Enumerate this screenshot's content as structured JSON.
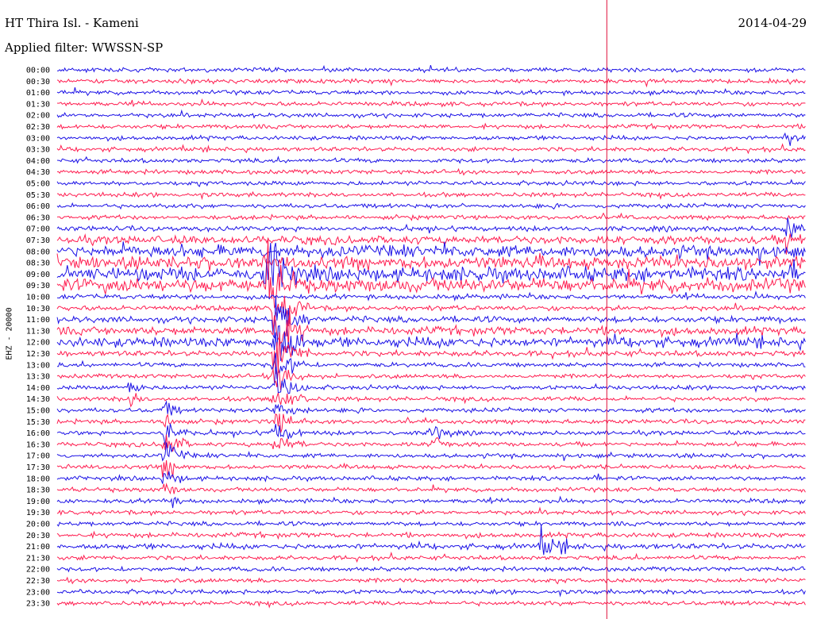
{
  "header": {
    "station": "HT Thira Isl. - Kameni",
    "filter": "Applied filter: WWSSN-SP",
    "date": "2014-04-29"
  },
  "channel_label": "EHZ - 20000",
  "colors": {
    "trace_a": "#1a10e6",
    "trace_b": "#ff1c4f",
    "marker": "#e0103a",
    "background": "#ffffff"
  },
  "chart_data": {
    "type": "line",
    "title": "HT Thira Isl. - Kameni",
    "subtitle": "Applied filter: WWSSN-SP",
    "ylabel": "EHZ - 20000",
    "row_labels": [
      "00:00",
      "00:30",
      "01:00",
      "01:30",
      "02:00",
      "02:30",
      "03:00",
      "03:30",
      "04:00",
      "04:30",
      "05:00",
      "05:30",
      "06:00",
      "06:30",
      "07:00",
      "07:30",
      "08:00",
      "08:30",
      "09:00",
      "09:30",
      "10:00",
      "10:30",
      "11:00",
      "11:30",
      "12:00",
      "12:30",
      "13:00",
      "13:30",
      "14:00",
      "14:30",
      "15:00",
      "15:30",
      "16:00",
      "16:30",
      "17:00",
      "17:30",
      "18:00",
      "18:30",
      "19:00",
      "19:30",
      "20:00",
      "20:30",
      "21:00",
      "21:30",
      "22:00",
      "22:30",
      "23:00",
      "23:30"
    ],
    "row_duration_min": 30,
    "trace_colors_alternate": [
      "blue",
      "red"
    ],
    "noise_level": [
      0.3,
      0.3,
      0.3,
      0.3,
      0.3,
      0.3,
      0.3,
      0.3,
      0.3,
      0.3,
      0.3,
      0.3,
      0.3,
      0.3,
      0.4,
      0.9,
      1.5,
      1.6,
      1.8,
      1.8,
      0.4,
      0.4,
      0.6,
      0.9,
      1.2,
      0.5,
      0.3,
      0.3,
      0.3,
      0.3,
      0.3,
      0.3,
      0.3,
      0.3,
      0.3,
      0.3,
      0.3,
      0.3,
      0.3,
      0.3,
      0.3,
      0.4,
      0.5,
      0.3,
      0.3,
      0.3,
      0.3,
      0.3
    ],
    "events": [
      {
        "row": 18,
        "minute": 8.4,
        "amplitude": 4.5,
        "duration_min": 1.5
      },
      {
        "row": 19,
        "minute": 8.4,
        "amplitude": 4.5,
        "duration_min": 1.5
      },
      {
        "row": 21,
        "minute": 8.7,
        "amplitude": 4.0,
        "duration_min": 1.4
      },
      {
        "row": 22,
        "minute": 8.7,
        "amplitude": 4.0,
        "duration_min": 1.4
      },
      {
        "row": 23,
        "minute": 8.7,
        "amplitude": 4.0,
        "duration_min": 1.4
      },
      {
        "row": 24,
        "minute": 8.7,
        "amplitude": 4.2,
        "duration_min": 1.4
      },
      {
        "row": 25,
        "minute": 8.7,
        "amplitude": 3.0,
        "duration_min": 1.4
      },
      {
        "row": 26,
        "minute": 8.7,
        "amplitude": 2.4,
        "duration_min": 1.4
      },
      {
        "row": 27,
        "minute": 8.7,
        "amplitude": 2.2,
        "duration_min": 1.4
      },
      {
        "row": 28,
        "minute": 8.7,
        "amplitude": 2.2,
        "duration_min": 1.4
      },
      {
        "row": 29,
        "minute": 8.7,
        "amplitude": 2.0,
        "duration_min": 1.4
      },
      {
        "row": 30,
        "minute": 8.7,
        "amplitude": 1.8,
        "duration_min": 1.4
      },
      {
        "row": 31,
        "minute": 8.7,
        "amplitude": 1.6,
        "duration_min": 1.4
      },
      {
        "row": 32,
        "minute": 8.7,
        "amplitude": 1.4,
        "duration_min": 1.4
      },
      {
        "row": 33,
        "minute": 8.7,
        "amplitude": 1.2,
        "duration_min": 1.4
      },
      {
        "row": 28,
        "minute": 2.9,
        "amplitude": 1.4,
        "duration_min": 0.7
      },
      {
        "row": 29,
        "minute": 2.9,
        "amplitude": 1.1,
        "duration_min": 0.7
      },
      {
        "row": 30,
        "minute": 4.3,
        "amplitude": 1.2,
        "duration_min": 0.8
      },
      {
        "row": 31,
        "minute": 4.3,
        "amplitude": 1.6,
        "duration_min": 0.8
      },
      {
        "row": 32,
        "minute": 4.3,
        "amplitude": 2.2,
        "duration_min": 1.0
      },
      {
        "row": 33,
        "minute": 4.3,
        "amplitude": 2.4,
        "duration_min": 1.0
      },
      {
        "row": 34,
        "minute": 4.3,
        "amplitude": 2.0,
        "duration_min": 1.0
      },
      {
        "row": 35,
        "minute": 4.3,
        "amplitude": 1.6,
        "duration_min": 1.0
      },
      {
        "row": 36,
        "minute": 4.3,
        "amplitude": 1.2,
        "duration_min": 1.0
      },
      {
        "row": 37,
        "minute": 4.3,
        "amplitude": 1.0,
        "duration_min": 0.8
      },
      {
        "row": 38,
        "minute": 4.3,
        "amplitude": 1.0,
        "duration_min": 0.8
      },
      {
        "row": 32,
        "minute": 15.0,
        "amplitude": 1.8,
        "duration_min": 0.8
      },
      {
        "row": 33,
        "minute": 15.0,
        "amplitude": 1.6,
        "duration_min": 0.8
      },
      {
        "row": 42,
        "minute": 19.4,
        "amplitude": 1.4,
        "duration_min": 1.6
      },
      {
        "row": 6,
        "minute": 29.2,
        "amplitude": 1.5,
        "duration_min": 0.5
      },
      {
        "row": 14,
        "minute": 29.2,
        "amplitude": 2.2,
        "duration_min": 0.6
      },
      {
        "row": 15,
        "minute": 29.2,
        "amplitude": 2.0,
        "duration_min": 0.6
      }
    ],
    "marker_minute": 22.0
  }
}
